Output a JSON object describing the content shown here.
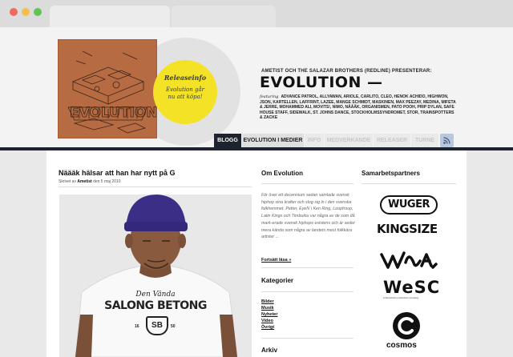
{
  "site": {
    "presents": "AMETIST OCH THE SALAZAR BROTHERS (REDLINE) PRESENTERAR:",
    "title": "EVOLUTION —",
    "featuring_label": "featuring",
    "featuring_text": "ADVANCE PATROL, ALLYAWAN, ARIOLE, CARLITO, CLEO, HENOK ACHIDO, HIGHWON, JSON, KARTELLEN, LAFFRINT, LAZEE, MANGE SCHMIDT, MASKINEN, MAX PEEZAY, MEDINA, MIFETA & JERRE, MOHAMMED ALI, MOVITS!, NIMO, NÅÄÄK, ORGANISMEN, PATO POOH, PRIP DYLAN, SAFE HOUSE STAFF, SIDEWALK, ST. JOHNS DANCE, STOCKHOLMSSYNDROMET, STOR, TRAINSPOTTERS & ZACKE"
  },
  "release": {
    "title": "Releaseinfo",
    "subtitle": "Evolution går nu att köpa!"
  },
  "nav": [
    {
      "label": "BLOGG",
      "state": "active"
    },
    {
      "label": "EVOLUTION I MEDIER",
      "state": "highlight"
    },
    {
      "label": "INFO",
      "state": "disabled"
    },
    {
      "label": "MEDVERKANDE",
      "state": "disabled"
    },
    {
      "label": "RELEASER",
      "state": "disabled"
    },
    {
      "label": "TURNE",
      "state": "disabled"
    }
  ],
  "post": {
    "title": "Näääk hälsar att han har nytt på G",
    "meta_prefix": "Skrivet av",
    "author": "Ametist",
    "date": "den 5 maj 2010",
    "shirt_top": "Den Vända",
    "shirt_main": "SALONG BETONG",
    "shirt_badge": "SB",
    "shirt_num_left": "16",
    "shirt_num_right": "50"
  },
  "about": {
    "heading": "Om Evolution",
    "text": "För över ett decennium sedan samlade svensk hiphop sina krafter och slog sig in i den svenska folkhemmet. Petter, EyeN´i Ken Ring, Loopfroop, Latin Kings och Timbuktu var några av de som då mark-erade svensk hiphops existens och är seder mera kända som några av landets mest folkkära artister ...",
    "read_more": "Fortsätt läsa »"
  },
  "categories": {
    "heading": "Kategorier",
    "items": [
      "Bilder",
      "Musik",
      "Nyheter",
      "Video",
      "Övrigt"
    ]
  },
  "archive": {
    "heading": "Arkiv"
  },
  "partners": {
    "heading": "Samarbetspartners",
    "wuger": "WUGER",
    "kingsize": "KINGSIZE",
    "graffiti": "WHOA",
    "wesc": "WeSC",
    "wesc_tagline": "a WeActivist production company",
    "cosmos": "cosmos"
  },
  "colors": {
    "navy": "#1d2430",
    "badge_yellow": "#f3e225",
    "cover_brown": "#b76b42",
    "hat_purple": "#3b2e86"
  }
}
